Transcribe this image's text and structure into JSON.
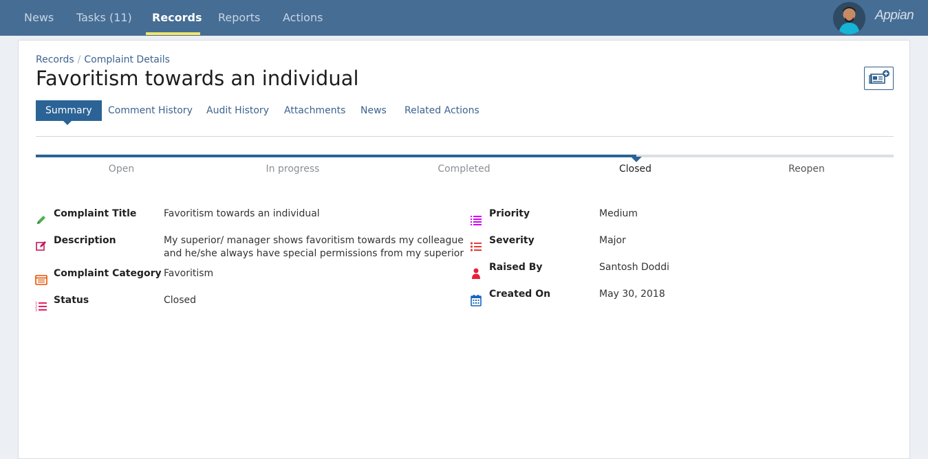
{
  "nav": {
    "items": [
      {
        "label": "News"
      },
      {
        "label": "Tasks (11)"
      },
      {
        "label": "Records"
      },
      {
        "label": "Reports"
      },
      {
        "label": "Actions"
      }
    ],
    "active": "Records",
    "logo": "Appian"
  },
  "breadcrumb": {
    "root": "Records",
    "separator": "/",
    "current": "Complaint Details"
  },
  "page_title": "Favoritism towards an individual",
  "tabs": [
    {
      "label": "Summary"
    },
    {
      "label": "Comment History"
    },
    {
      "label": "Audit History"
    },
    {
      "label": "Attachments"
    },
    {
      "label": "News"
    },
    {
      "label": "Related Actions"
    }
  ],
  "progress": {
    "stages": [
      "Open",
      "In progress",
      "Completed",
      "Closed",
      "Reopen"
    ],
    "current_index": 3,
    "completion_fraction": 0.7
  },
  "fields_left": [
    {
      "label": "Complaint Title",
      "value": "Favoritism towards an individual",
      "icon": "pencil-icon"
    },
    {
      "label": "Description",
      "value_lines": [
        "My superior/ manager shows favoritism towards my colleague",
        "and he/she always have special permissions from my superior"
      ],
      "icon": "edit-icon"
    },
    {
      "label": "Complaint Category",
      "value": "Favoritism",
      "icon": "list-card-icon"
    },
    {
      "label": "Status",
      "value": "Closed",
      "icon": "numbered-list-icon"
    }
  ],
  "fields_right": [
    {
      "label": "Priority",
      "value": "Medium",
      "icon": "list-icon"
    },
    {
      "label": "Severity",
      "value": "Major",
      "icon": "bullet-list-icon"
    },
    {
      "label": "Raised By",
      "value": "Santosh Doddi",
      "icon": "user-icon"
    },
    {
      "label": "Created On",
      "value": "May 30, 2018",
      "icon": "calendar-icon"
    }
  ],
  "colors": {
    "nav_bg": "#466d94",
    "accent": "#2b6396",
    "nav_underline": "#f3e66a",
    "link": "#3c638f"
  }
}
